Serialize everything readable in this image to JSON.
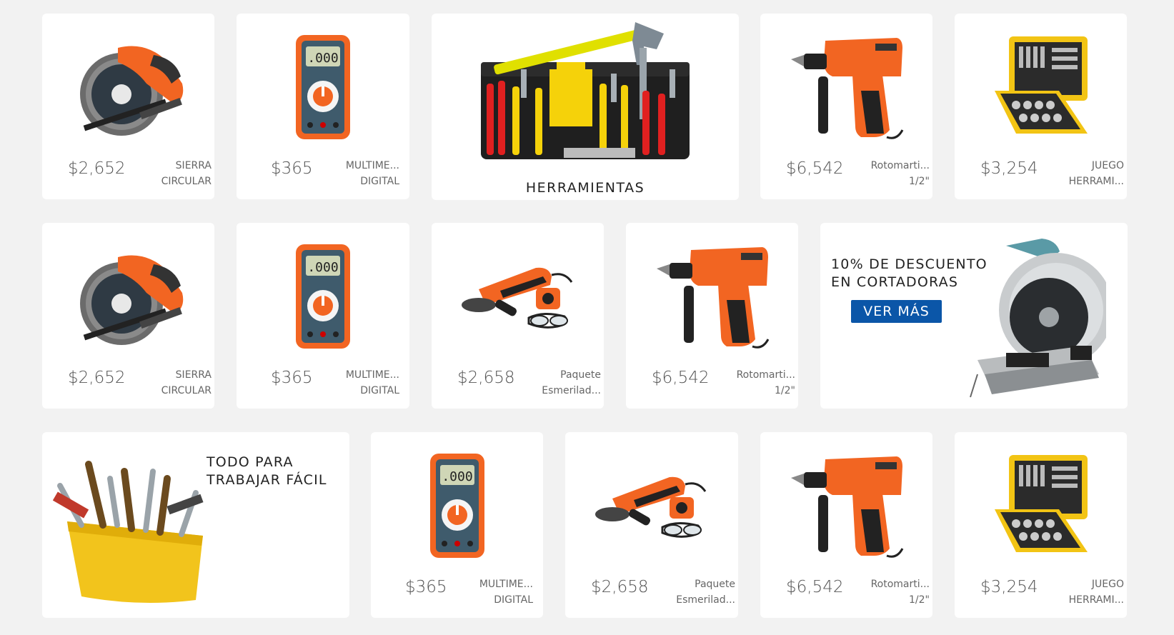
{
  "products": {
    "saw": {
      "price": "$2,652",
      "name_line1": "SIERRA",
      "name_line2": "CIRCULAR"
    },
    "multimeter": {
      "price": "$365",
      "name_line1": "MULTIME...",
      "name_line2": "DIGITAL"
    },
    "drill": {
      "price": "$6,542",
      "name_line1": "Rotomarti...",
      "name_line2": "1/2\""
    },
    "toolkit": {
      "price": "$3,254",
      "name_line1": "JUEGO",
      "name_line2": "HERRAMI..."
    },
    "grinder": {
      "price": "$2,658",
      "name_line1": "Paquete",
      "name_line2": "Esmerilad..."
    }
  },
  "featured": {
    "title": "HERRAMIENTAS"
  },
  "promo": {
    "line1": "10% DE DESCUENTO",
    "line2": "EN CORTADORAS",
    "button_label": "VER MÁS",
    "button_color": "#0b56a8"
  },
  "banner": {
    "line1": "TODO PARA",
    "line2": "TRABAJAR FÁCIL"
  },
  "icons": {
    "saw": "circular-saw-icon",
    "multimeter": "multimeter-icon",
    "drill": "hammer-drill-icon",
    "toolkit": "socket-set-icon",
    "grinder": "angle-grinder-icon",
    "toolbox": "toolbox-icon",
    "cutoff": "cutoff-saw-icon",
    "toolbucket": "tool-bucket-icon"
  },
  "accent_color": "#f26522"
}
